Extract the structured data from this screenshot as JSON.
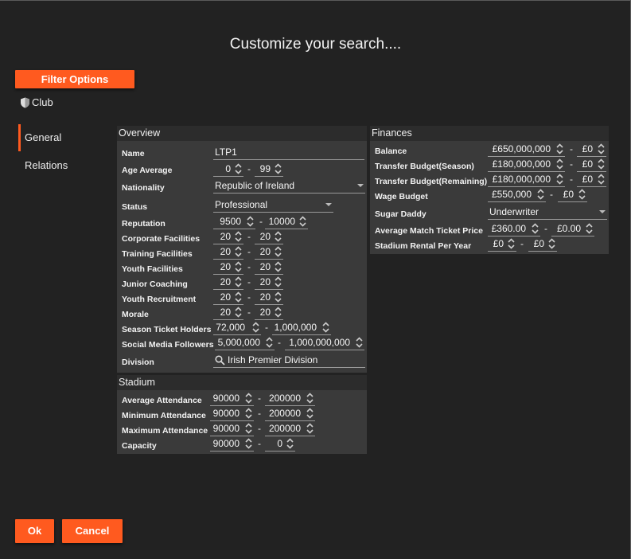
{
  "title": "Customize your search....",
  "filter_options": "Filter Options",
  "club_label": "Club",
  "nav": {
    "general": "General",
    "relations": "Relations"
  },
  "overview": {
    "header": "Overview",
    "name_label": "Name",
    "name_value": "LTP1",
    "age_label": "Age Average",
    "age_min": "0",
    "age_max": "99",
    "nationality_label": "Nationality",
    "nationality_value": "Republic of Ireland",
    "status_label": "Status",
    "status_value": "Professional",
    "reputation_label": "Reputation",
    "reputation_min": "9500",
    "reputation_max": "10000",
    "corp_label": "Corporate Facilities",
    "corp_min": "20",
    "corp_max": "20",
    "training_label": "Training Facilities",
    "training_min": "20",
    "training_max": "20",
    "youth_label": "Youth Facilities",
    "youth_min": "20",
    "youth_max": "20",
    "junior_label": "Junior Coaching",
    "junior_min": "20",
    "junior_max": "20",
    "recruit_label": "Youth Recruitment",
    "recruit_min": "20",
    "recruit_max": "20",
    "morale_label": "Morale",
    "morale_min": "20",
    "morale_max": "20",
    "season_label": "Season Ticket Holders",
    "season_min": "72,000",
    "season_max": "1,000,000",
    "social_label": "Social Media Followers",
    "social_min": "5,000,000",
    "social_max": "1,000,000,000",
    "division_label": "Division",
    "division_value": "Irish Premier Division"
  },
  "stadium": {
    "header": "Stadium",
    "avg_label": "Average Attendance",
    "avg_min": "90000",
    "avg_max": "200000",
    "min_label": "Minimum Attendance",
    "min_min": "90000",
    "min_max": "200000",
    "max_label": "Maximum Attendance",
    "max_min": "90000",
    "max_max": "200000",
    "cap_label": "Capacity",
    "cap_min": "90000",
    "cap_max": "0"
  },
  "finances": {
    "header": "Finances",
    "balance_label": "Balance",
    "balance_min": "£650,000,000",
    "balance_max": "£0",
    "tb_season_label": "Transfer Budget(Season)",
    "tb_season_min": "£180,000,000",
    "tb_season_max": "£0",
    "tb_rem_label": "Transfer Budget(Remaining)",
    "tb_rem_min": "£180,000,000",
    "tb_rem_max": "£0",
    "wage_label": "Wage Budget",
    "wage_min": "£550,000",
    "wage_max": "£0",
    "sugar_label": "Sugar Daddy",
    "sugar_value": "Underwriter",
    "ticket_label": "Average Match Ticket Price",
    "ticket_min": "£360.00",
    "ticket_max": "£0.00",
    "rental_label": "Stadium Rental Per Year",
    "rental_min": "£0",
    "rental_max": "£0"
  },
  "dash": "-",
  "buttons": {
    "ok": "Ok",
    "cancel": "Cancel"
  },
  "colors": {
    "accent": "#ff5a1f",
    "background": "#222222",
    "panel": "#3a3a3a"
  }
}
